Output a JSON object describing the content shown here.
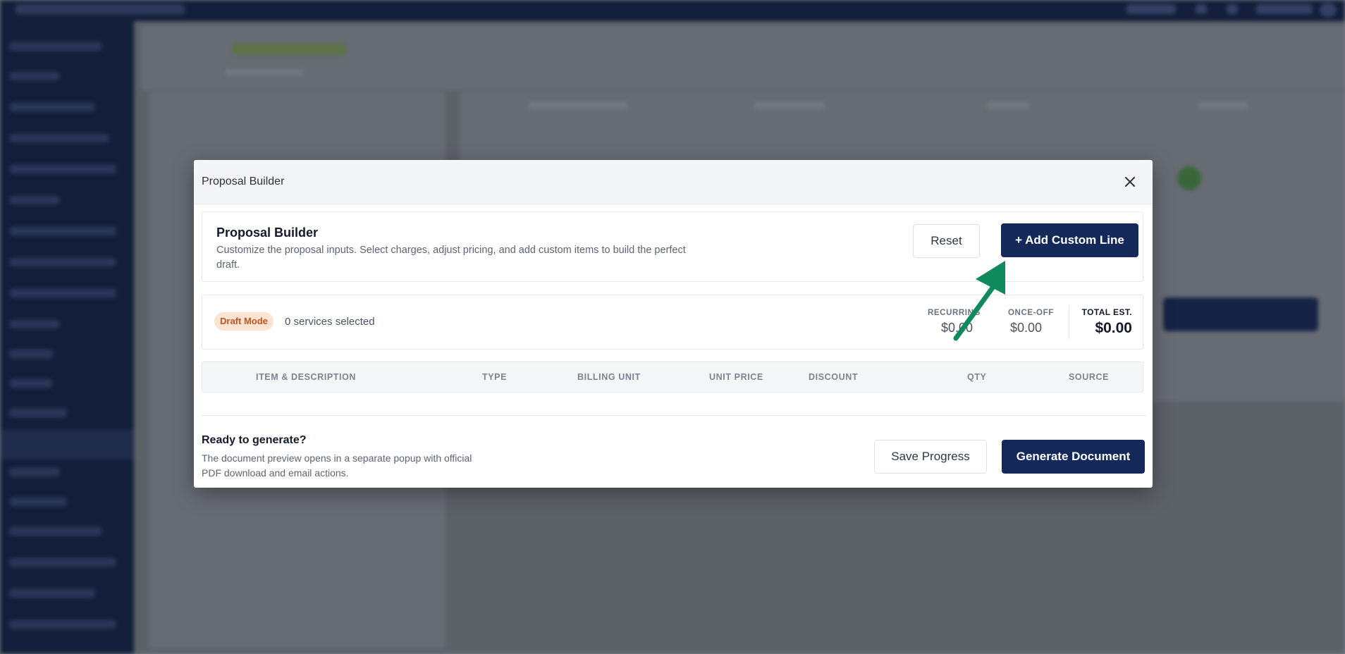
{
  "modal": {
    "title": "Proposal Builder",
    "close_icon": "close-icon"
  },
  "intro": {
    "title": "Proposal Builder",
    "description": "Customize the proposal inputs. Select charges, adjust pricing, and add custom items to build the perfect draft.",
    "reset_label": "Reset",
    "add_label": "+ Add Custom Line"
  },
  "status": {
    "badge": "Draft Mode",
    "services": "0 services selected",
    "recurring_label": "RECURRING",
    "recurring_value": "$0.00",
    "onceoff_label": "ONCE-OFF",
    "onceoff_value": "$0.00",
    "total_label": "TOTAL EST.",
    "total_value": "$0.00"
  },
  "table": {
    "columns": [
      "ITEM & DESCRIPTION",
      "TYPE",
      "BILLING UNIT",
      "UNIT PRICE",
      "DISCOUNT",
      "QTY",
      "SOURCE"
    ]
  },
  "footer": {
    "title": "Ready to generate?",
    "description": "The document preview opens in a separate popup with official PDF download and email actions.",
    "save_label": "Save Progress",
    "generate_label": "Generate Document"
  },
  "colors": {
    "primary": "#14295a",
    "badge_bg": "#fde3d2",
    "badge_text": "#c2541c",
    "arrow": "#0f8a5c"
  },
  "annotation": {
    "icon": "arrow-up-right-icon"
  }
}
